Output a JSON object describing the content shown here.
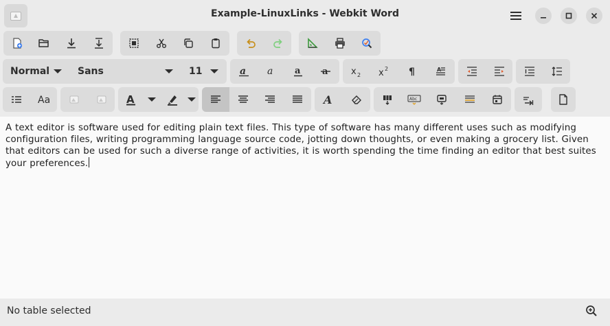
{
  "window": {
    "title": "Example-LinuxLinks - Webkit Word",
    "app_icon": "document-app-icon",
    "menu_icon": "hamburger-menu-icon",
    "minimize_icon": "minimize-icon",
    "maximize_icon": "maximize-icon",
    "close_icon": "close-icon"
  },
  "toolbar1": {
    "buttons": [
      {
        "name": "new-document-button",
        "icon": "new-document-icon"
      },
      {
        "name": "open-button",
        "icon": "open-folder-icon"
      },
      {
        "name": "save-button",
        "icon": "download-icon"
      },
      {
        "name": "save-as-button",
        "icon": "download-to-line-icon"
      },
      {
        "name": "select-all-button",
        "icon": "select-all-icon"
      },
      {
        "name": "cut-button",
        "icon": "scissors-icon"
      },
      {
        "name": "copy-button",
        "icon": "copy-icon"
      },
      {
        "name": "paste-button",
        "icon": "paste-icon"
      },
      {
        "name": "undo-button",
        "icon": "undo-icon"
      },
      {
        "name": "redo-button",
        "icon": "redo-icon"
      },
      {
        "name": "insert-chart-button",
        "icon": "ruler-triangle-icon"
      },
      {
        "name": "print-button",
        "icon": "printer-icon"
      },
      {
        "name": "spellcheck-button",
        "icon": "search-replace-icon"
      }
    ]
  },
  "toolbar2": {
    "style_select": "Normal",
    "font_select": "Sans",
    "size_select": "11"
  },
  "status": {
    "text": "No table selected",
    "zoom_icon": "zoom-in-icon"
  },
  "document": {
    "text": "A text editor is software used for editing plain text files. This type of software has many different uses such as modifying configuration files, writing programming language source code, jotting down thoughts, or even making a grocery list. Given that editors can be used for such a diverse range of activities, it is worth spending the time finding an editor that best suites your preferences."
  },
  "colors": {
    "undo_accent": "#c78f1b",
    "redo_accent": "#4caf50",
    "new_doc_accent": "#3d7ff0",
    "chart_accent": "#3c9a3c"
  }
}
